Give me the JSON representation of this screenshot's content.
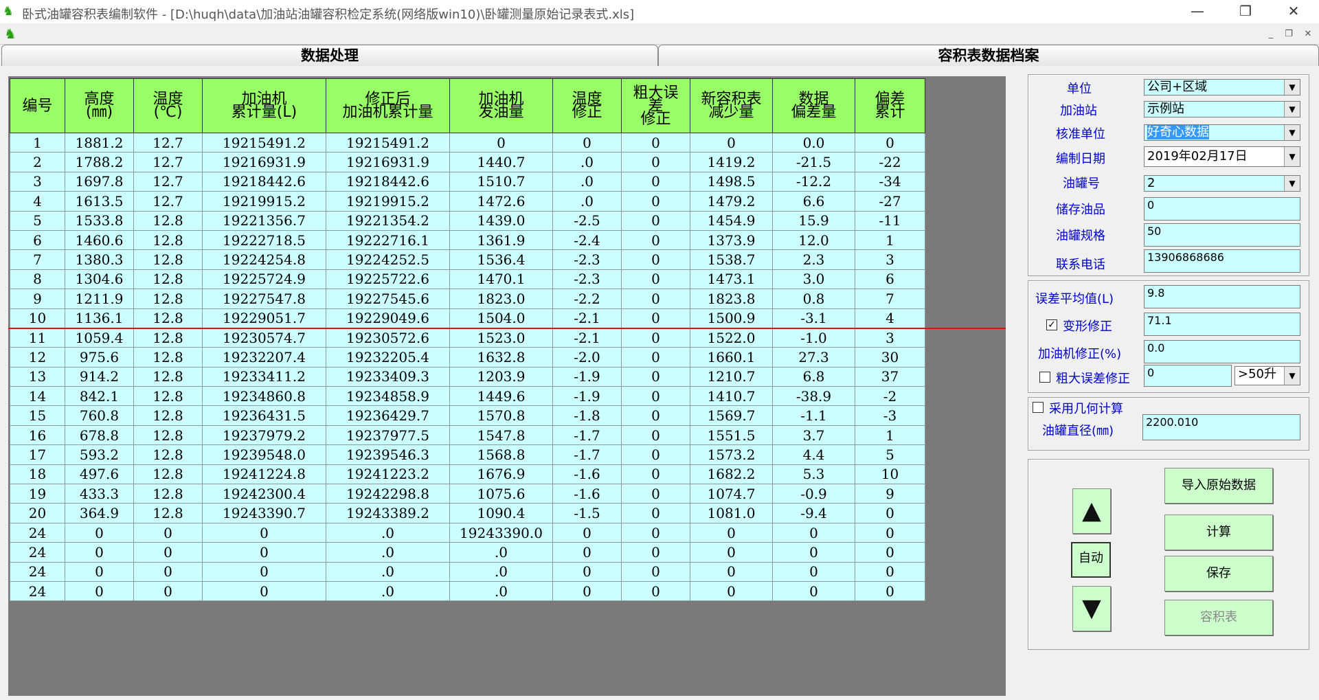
{
  "window": {
    "title": "卧式油罐容积表编制软件 - [D:\\huqh\\data\\加油站油罐容积检定系统(网络版win10)\\卧罐测量原始记录表式.xls]",
    "minimize": "—",
    "restore": "❐",
    "close": "✕"
  },
  "mdi": {
    "minimize": "_",
    "restore": "❐",
    "close": "✕"
  },
  "tabs": [
    {
      "label": "数据处理"
    },
    {
      "label": "容积表数据档案"
    }
  ],
  "table": {
    "headers": [
      "编号",
      "高度\n(㎜)",
      "温度\n(℃)",
      "加油机\n累计量(L)",
      "修正后\n加油机累计量",
      "加油机\n发油量",
      "温度\n修正",
      "粗大误\n差\n修正",
      "新容积表\n减少量",
      "数据\n偏差量",
      "偏差\n累计"
    ],
    "rows": [
      [
        "1",
        "1881.2",
        "12.7",
        "19215491.2",
        "19215491.2",
        "0",
        "0",
        "0",
        "0",
        "0.0",
        "0"
      ],
      [
        "2",
        "1788.2",
        "12.7",
        "19216931.9",
        "19216931.9",
        "1440.7",
        ".0",
        "0",
        "1419.2",
        "-21.5",
        "-22"
      ],
      [
        "3",
        "1697.8",
        "12.7",
        "19218442.6",
        "19218442.6",
        "1510.7",
        ".0",
        "0",
        "1498.5",
        "-12.2",
        "-34"
      ],
      [
        "4",
        "1613.5",
        "12.7",
        "19219915.2",
        "19219915.2",
        "1472.6",
        ".0",
        "0",
        "1479.2",
        "6.6",
        "-27"
      ],
      [
        "5",
        "1533.8",
        "12.8",
        "19221356.7",
        "19221354.2",
        "1439.0",
        "-2.5",
        "0",
        "1454.9",
        "15.9",
        "-11"
      ],
      [
        "6",
        "1460.6",
        "12.8",
        "19222718.5",
        "19222716.1",
        "1361.9",
        "-2.4",
        "0",
        "1373.9",
        "12.0",
        "1"
      ],
      [
        "7",
        "1380.3",
        "12.8",
        "19224254.8",
        "19224252.5",
        "1536.4",
        "-2.3",
        "0",
        "1538.7",
        "2.3",
        "3"
      ],
      [
        "8",
        "1304.6",
        "12.8",
        "19225724.9",
        "19225722.6",
        "1470.1",
        "-2.3",
        "0",
        "1473.1",
        "3.0",
        "6"
      ],
      [
        "9",
        "1211.9",
        "12.8",
        "19227547.8",
        "19227545.6",
        "1823.0",
        "-2.2",
        "0",
        "1823.8",
        "0.8",
        "7"
      ],
      [
        "10",
        "1136.1",
        "12.8",
        "19229051.7",
        "19229049.6",
        "1504.0",
        "-2.1",
        "0",
        "1500.9",
        "-3.1",
        "4"
      ],
      [
        "11",
        "1059.4",
        "12.8",
        "19230574.7",
        "19230572.6",
        "1523.0",
        "-2.1",
        "0",
        "1522.0",
        "-1.0",
        "3"
      ],
      [
        "12",
        "975.6",
        "12.8",
        "19232207.4",
        "19232205.4",
        "1632.8",
        "-2.0",
        "0",
        "1660.1",
        "27.3",
        "30"
      ],
      [
        "13",
        "914.2",
        "12.8",
        "19233411.2",
        "19233409.3",
        "1203.9",
        "-1.9",
        "0",
        "1210.7",
        "6.8",
        "37"
      ],
      [
        "14",
        "842.1",
        "12.8",
        "19234860.8",
        "19234858.9",
        "1449.6",
        "-1.9",
        "0",
        "1410.7",
        "-38.9",
        "-2"
      ],
      [
        "15",
        "760.8",
        "12.8",
        "19236431.5",
        "19236429.7",
        "1570.8",
        "-1.8",
        "0",
        "1569.7",
        "-1.1",
        "-3"
      ],
      [
        "16",
        "678.8",
        "12.8",
        "19237979.2",
        "19237977.5",
        "1547.8",
        "-1.7",
        "0",
        "1551.5",
        "3.7",
        "1"
      ],
      [
        "17",
        "593.2",
        "12.8",
        "19239548.0",
        "19239546.3",
        "1568.8",
        "-1.7",
        "0",
        "1573.2",
        "4.4",
        "5"
      ],
      [
        "18",
        "497.6",
        "12.8",
        "19241224.8",
        "19241223.2",
        "1676.9",
        "-1.6",
        "0",
        "1682.2",
        "5.3",
        "10"
      ],
      [
        "19",
        "433.3",
        "12.8",
        "19242300.4",
        "19242298.8",
        "1075.6",
        "-1.6",
        "0",
        "1074.7",
        "-0.9",
        "9"
      ],
      [
        "20",
        "364.9",
        "12.8",
        "19243390.7",
        "19243389.2",
        "1090.4",
        "-1.5",
        "0",
        "1081.0",
        "-9.4",
        "0"
      ],
      [
        "24",
        "0",
        "0",
        "0",
        ".0",
        "19243390.0",
        "0",
        "0",
        "0",
        "0",
        "0"
      ],
      [
        "24",
        "0",
        "0",
        "0",
        ".0",
        ".0",
        "0",
        "0",
        "0",
        "0",
        "0"
      ],
      [
        "24",
        "0",
        "0",
        "0",
        ".0",
        ".0",
        "0",
        "0",
        "0",
        "0",
        "0"
      ],
      [
        "24",
        "0",
        "0",
        "0",
        ".0",
        ".0",
        "0",
        "0",
        "0",
        "0",
        "0"
      ]
    ]
  },
  "info": {
    "unit_label": "单位",
    "unit_value": "公司+区域",
    "station_label": "加油站",
    "station_value": "示例站",
    "verifier_label": "核准单位",
    "verifier_value": "好奇心数据",
    "date_label": "编制日期",
    "date_value": "2019年02月17日",
    "tank_label": "油罐号",
    "tank_value": "2",
    "oil_label": "储存油品",
    "oil_value": "0",
    "spec_label": "油罐规格",
    "spec_value": "50",
    "phone_label": "联系电话",
    "phone_value": "13906868686"
  },
  "params": {
    "avg_error_label": "误差平均值(L)",
    "avg_error_value": "9.8",
    "deform_label": "变形修正",
    "deform_value": "71.1",
    "deform_checked": true,
    "dispenser_label": "加油机修正(%)",
    "dispenser_value": "0.0",
    "gross_label": "粗大误差修正",
    "gross_value": "0",
    "gross_checked": false,
    "gross_threshold": ">50升"
  },
  "geometry": {
    "use_geo_label": "采用几何计算",
    "use_geo_checked": false,
    "diameter_label": "油罐直径(㎜)",
    "diameter_value": "2200.010"
  },
  "actions": {
    "import_label": "导入原始数据",
    "calc_label": "计算",
    "save_label": "保存",
    "table_label": "容积表",
    "auto_label": "自动",
    "up_icon": "▲",
    "down_icon": "▼",
    "check_mark": "✓",
    "dropdown_icon": "▼"
  }
}
